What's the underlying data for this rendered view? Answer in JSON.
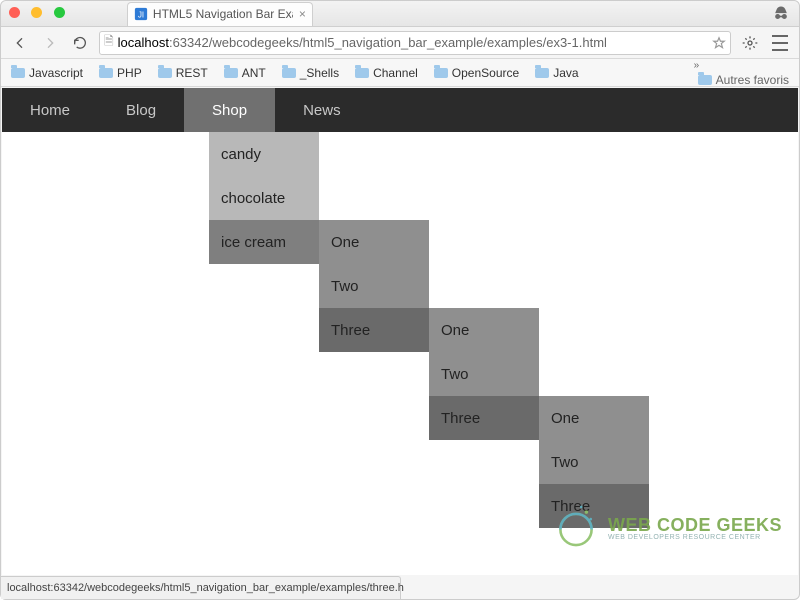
{
  "window": {
    "tab_title": "HTML5 Navigation Bar Exa",
    "url_host": "localhost",
    "url_rest": ":63342/webcodegeeks/html5_navigation_bar_example/examples/ex3-1.html",
    "status_text": "localhost:63342/webcodegeeks/html5_navigation_bar_example/examples/three.h"
  },
  "bookmarks": {
    "items": [
      "Javascript",
      "PHP",
      "REST",
      "ANT",
      "_Shells",
      "Channel",
      "OpenSource",
      "Java"
    ],
    "overflow_symbol": "»",
    "other_label": "Autres favoris"
  },
  "nav": {
    "items": [
      "Home",
      "Blog",
      "Shop",
      "News"
    ],
    "active_index": 2,
    "submenu": {
      "items": [
        "candy",
        "chocolate",
        "ice cream"
      ],
      "hover_index": 2,
      "children": {
        "items": [
          "One",
          "Two",
          "Three"
        ],
        "hover_index": 2,
        "children": {
          "items": [
            "One",
            "Two",
            "Three"
          ],
          "hover_index": 2,
          "children": {
            "items": [
              "One",
              "Two",
              "Three"
            ]
          }
        }
      }
    }
  },
  "watermark": {
    "title": "WEB CODE GEEKS",
    "subtitle": "WEB DEVELOPERS RESOURCE CENTER"
  }
}
